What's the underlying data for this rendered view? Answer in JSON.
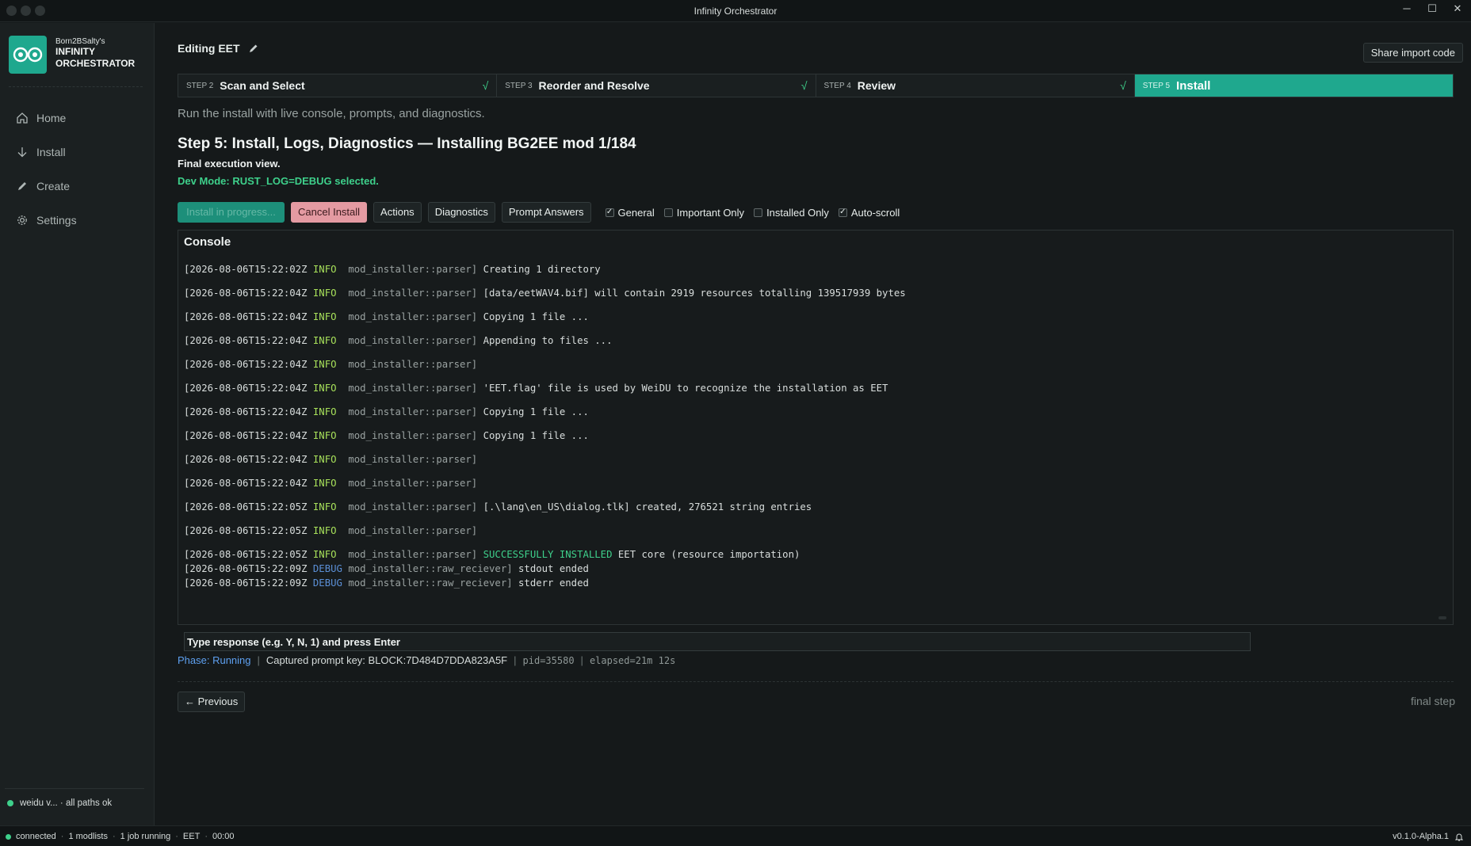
{
  "app_title": "Infinity Orchestrator",
  "brand": {
    "owner": "Born2BSalty's",
    "name_line1": "INFINITY",
    "name_line2": "ORCHESTRATOR"
  },
  "nav": [
    {
      "label": "Home",
      "icon": "home-icon"
    },
    {
      "label": "Install",
      "icon": "download-icon"
    },
    {
      "label": "Create",
      "icon": "pencil-icon"
    },
    {
      "label": "Settings",
      "icon": "gear-icon"
    }
  ],
  "sidebar_status": "weidu v... · all paths ok",
  "editing_label": "Editing EET",
  "share_label": "Share import code",
  "steps": [
    {
      "num": "STEP 2",
      "label": "Scan and Select",
      "check": "√"
    },
    {
      "num": "STEP 3",
      "label": "Reorder and Resolve",
      "check": "√"
    },
    {
      "num": "STEP 4",
      "label": "Review",
      "check": "√"
    },
    {
      "num": "STEP 5",
      "label": "Install",
      "check": ""
    }
  ],
  "subtitle": "Run the install with live console, prompts, and diagnostics.",
  "heading": "Step 5: Install, Logs, Diagnostics — Installing BG2EE mod 1/184",
  "final_view": "Final execution view.",
  "dev_mode": "Dev Mode: RUST_LOG=DEBUG selected.",
  "toolbar": {
    "install_progress": "Install in progress...",
    "cancel": "Cancel Install",
    "actions": "Actions",
    "diagnostics": "Diagnostics",
    "prompt_answers": "Prompt Answers",
    "filters": [
      {
        "label": "General",
        "checked": true
      },
      {
        "label": "Important Only",
        "checked": false
      },
      {
        "label": "Installed Only",
        "checked": false
      },
      {
        "label": "Auto-scroll",
        "checked": true
      }
    ]
  },
  "console": {
    "title": "Console",
    "lines": [
      {
        "ts": "[2026-08-06T15:22:02Z",
        "level": "INFO",
        "mod": "mod_installer::parser]",
        "msg": "Creating 1 directory",
        "gap": true
      },
      {
        "ts": "[2026-08-06T15:22:04Z",
        "level": "INFO",
        "mod": "mod_installer::parser]",
        "msg": "[data/eetWAV4.bif] will contain 2919 resources totalling 139517939 bytes",
        "gap": true
      },
      {
        "ts": "[2026-08-06T15:22:04Z",
        "level": "INFO",
        "mod": "mod_installer::parser]",
        "msg": "Copying 1 file ...",
        "gap": true
      },
      {
        "ts": "[2026-08-06T15:22:04Z",
        "level": "INFO",
        "mod": "mod_installer::parser]",
        "msg": "Appending to files ...",
        "gap": true
      },
      {
        "ts": "[2026-08-06T15:22:04Z",
        "level": "INFO",
        "mod": "mod_installer::parser]",
        "msg": "",
        "gap": true
      },
      {
        "ts": "[2026-08-06T15:22:04Z",
        "level": "INFO",
        "mod": "mod_installer::parser]",
        "msg": "'EET.flag' file is used by WeiDU to recognize the installation as EET",
        "gap": true
      },
      {
        "ts": "[2026-08-06T15:22:04Z",
        "level": "INFO",
        "mod": "mod_installer::parser]",
        "msg": "Copying 1 file ...",
        "gap": true
      },
      {
        "ts": "[2026-08-06T15:22:04Z",
        "level": "INFO",
        "mod": "mod_installer::parser]",
        "msg": "Copying 1 file ...",
        "gap": true
      },
      {
        "ts": "[2026-08-06T15:22:04Z",
        "level": "INFO",
        "mod": "mod_installer::parser]",
        "msg": "",
        "gap": true
      },
      {
        "ts": "[2026-08-06T15:22:04Z",
        "level": "INFO",
        "mod": "mod_installer::parser]",
        "msg": "",
        "gap": true
      },
      {
        "ts": "[2026-08-06T15:22:05Z",
        "level": "INFO",
        "mod": "mod_installer::parser]",
        "msg": "[.\\lang\\en_US\\dialog.tlk] created, 276521 string entries",
        "gap": true
      },
      {
        "ts": "[2026-08-06T15:22:05Z",
        "level": "INFO",
        "mod": "mod_installer::parser]",
        "msg": "",
        "gap": true
      },
      {
        "ts": "[2026-08-06T15:22:05Z",
        "level": "INFO",
        "mod": "mod_installer::parser]",
        "success": "SUCCESSFULLY INSTALLED",
        "msg": " EET core (resource importation)",
        "gap": true
      },
      {
        "ts": "[2026-08-06T15:22:09Z",
        "level": "DEBUG",
        "mod": "mod_installer::raw_reciever]",
        "msg": "stdout ended",
        "gap": false
      },
      {
        "ts": "[2026-08-06T15:22:09Z",
        "level": "DEBUG",
        "mod": "mod_installer::raw_reciever]",
        "msg": "stderr ended",
        "gap": false
      }
    ]
  },
  "response_placeholder": "Type response (e.g. Y, N, 1) and press Enter",
  "status": {
    "phase": "Phase: Running",
    "captured": "Captured prompt key: BLOCK:7D484D7DDA823A5F",
    "pid": "pid=35580",
    "elapsed": "elapsed=21m 12s"
  },
  "previous_label": "← Previous",
  "final_step_label": "final step",
  "bottom": {
    "connected": "connected",
    "modlists": "1 modlists",
    "jobs": "1 job running",
    "game": "EET",
    "time": "00:00",
    "version": "v0.1.0-Alpha.1"
  },
  "colors": {
    "accent": "#1fa88e",
    "success": "#3ed08b",
    "info": "#a7e05a",
    "debug": "#5b8fd6",
    "cancel": "#e49aa2"
  }
}
